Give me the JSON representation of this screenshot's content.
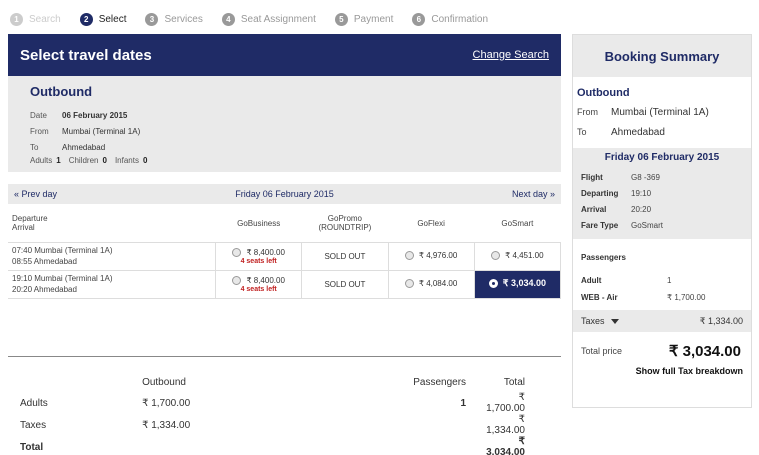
{
  "steps": [
    {
      "num": "1",
      "label": "Search"
    },
    {
      "num": "2",
      "label": "Select"
    },
    {
      "num": "3",
      "label": "Services"
    },
    {
      "num": "4",
      "label": "Seat Assignment"
    },
    {
      "num": "5",
      "label": "Payment"
    },
    {
      "num": "6",
      "label": "Confirmation"
    }
  ],
  "header": {
    "title": "Select travel dates",
    "change_search": "Change Search"
  },
  "outbound": {
    "title": "Outbound",
    "date_label": "Date",
    "date": "06 February 2015",
    "from_label": "From",
    "from": "Mumbai (Terminal 1A)",
    "to_label": "To",
    "to": "Ahmedabad",
    "adults_label": "Adults",
    "adults": "1",
    "children_label": "Children",
    "children": "0",
    "infants_label": "Infants",
    "infants": "0"
  },
  "datenav": {
    "prev": "« Prev day",
    "current": "Friday 06 February 2015",
    "next": "Next day »"
  },
  "fares": {
    "dep_header_1": "Departure",
    "dep_header_2": "Arrival",
    "columns": [
      "GoBusiness",
      "GoPromo",
      "GoFlexi",
      "GoSmart"
    ],
    "gopromo_sub": "(ROUNDTRIP)",
    "rows": [
      {
        "dep": "07:40 Mumbai (Terminal 1A)",
        "arr": "08:55 Ahmedabad",
        "gobusiness": "₹ 8,400.00",
        "gobusiness_seats": "4 seats left",
        "gopromo": "SOLD OUT",
        "goflexi": "₹ 4,976.00",
        "gosmart": "₹ 4,451.00"
      },
      {
        "dep": "19:10 Mumbai (Terminal 1A)",
        "arr": "20:20 Ahmedabad",
        "gobusiness": "₹ 8,400.00",
        "gobusiness_seats": "4 seats left",
        "gopromo": "SOLD OUT",
        "goflexi": "₹ 4,084.00",
        "gosmart": "₹ 3,034.00"
      }
    ]
  },
  "breakdown": {
    "headers": {
      "outbound": "Outbound",
      "passengers": "Passengers",
      "total": "Total"
    },
    "rows": [
      {
        "label": "Adults",
        "outbound": "₹ 1,700.00",
        "passengers": "1",
        "total": "₹ 1,700.00"
      },
      {
        "label": "Taxes",
        "outbound": "₹ 1,334.00",
        "passengers": "",
        "total": "₹ 1,334.00"
      }
    ],
    "total_label": "Total",
    "total_value": "₹ 3,034.00"
  },
  "summary": {
    "title": "Booking Summary",
    "section": "Outbound",
    "from_label": "From",
    "from": "Mumbai (Terminal 1A)",
    "to_label": "To",
    "to": "Ahmedabad",
    "date": "Friday 06 February 2015",
    "flight_label": "Flight",
    "flight": "G8 -369",
    "departing_label": "Departing",
    "departing": "19:10",
    "arrival_label": "Arrival",
    "arrival": "20:20",
    "fare_type_label": "Fare Type",
    "fare_type": "GoSmart",
    "passengers_label": "Passengers",
    "adult_label": "Adult",
    "adult": "1",
    "web_air_label": "WEB - Air",
    "web_air": "₹ 1,700.00",
    "taxes_label": "Taxes",
    "taxes": "₹ 1,334.00",
    "total_label": "Total price",
    "total": "₹ 3,034.00",
    "tax_link": "Show full Tax breakdown"
  },
  "colors": {
    "brand": "#1f2b66",
    "alert": "#c02020",
    "panel": "#eaeaea"
  }
}
